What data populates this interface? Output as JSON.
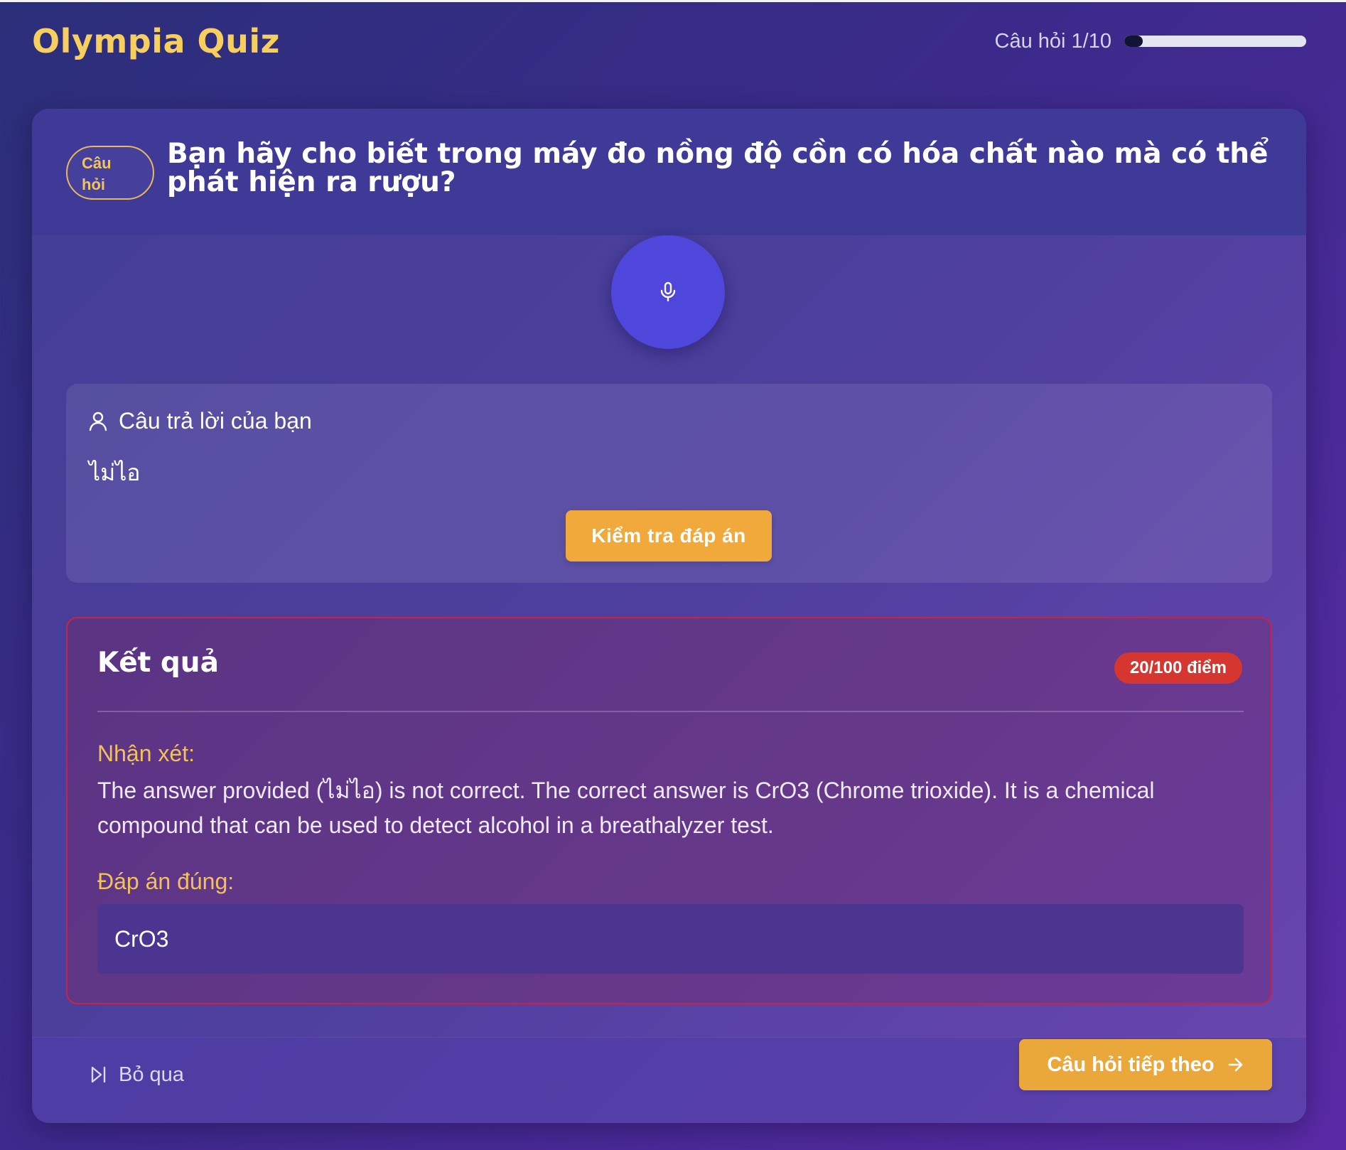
{
  "app": {
    "title": "Olympia Quiz"
  },
  "progress": {
    "label": "Câu hỏi 1/10",
    "fraction": 0.1
  },
  "question": {
    "badge": "Câu hỏi",
    "badge_line1": "Câu",
    "badge_line2": "hỏi",
    "text": "Bạn hãy cho biết trong máy đo nồng độ cồn có hóa chất nào mà có thể phát hiện ra rượu?"
  },
  "mic": {
    "icon": "microphone-icon"
  },
  "answer": {
    "label": "Câu trả lời của bạn",
    "icon": "user-icon",
    "value": "ไม่ไอ",
    "check_button": "Kiểm tra đáp án"
  },
  "result": {
    "title": "Kết quả",
    "score": "20/100 điểm",
    "comment_label": "Nhận xét:",
    "comment": "The answer provided (ไม่ไอ) is not correct. The correct answer is CrO3 (Chrome trioxide). It is a chemical compound that can be used to detect alcohol in a breathalyzer test.",
    "correct_label": "Đáp án đúng:",
    "correct_answer": "CrO3"
  },
  "footer": {
    "skip_label": "Bỏ qua",
    "skip_icon": "skip-forward-icon",
    "next_label": "Câu hỏi tiếp theo",
    "next_icon": "arrow-right-icon"
  },
  "colors": {
    "brand": "#f6cf5f",
    "accent_button": "#f0a93a",
    "mic": "#4f47dc",
    "score_badge": "#d5362f",
    "result_border": "#c4244a"
  }
}
